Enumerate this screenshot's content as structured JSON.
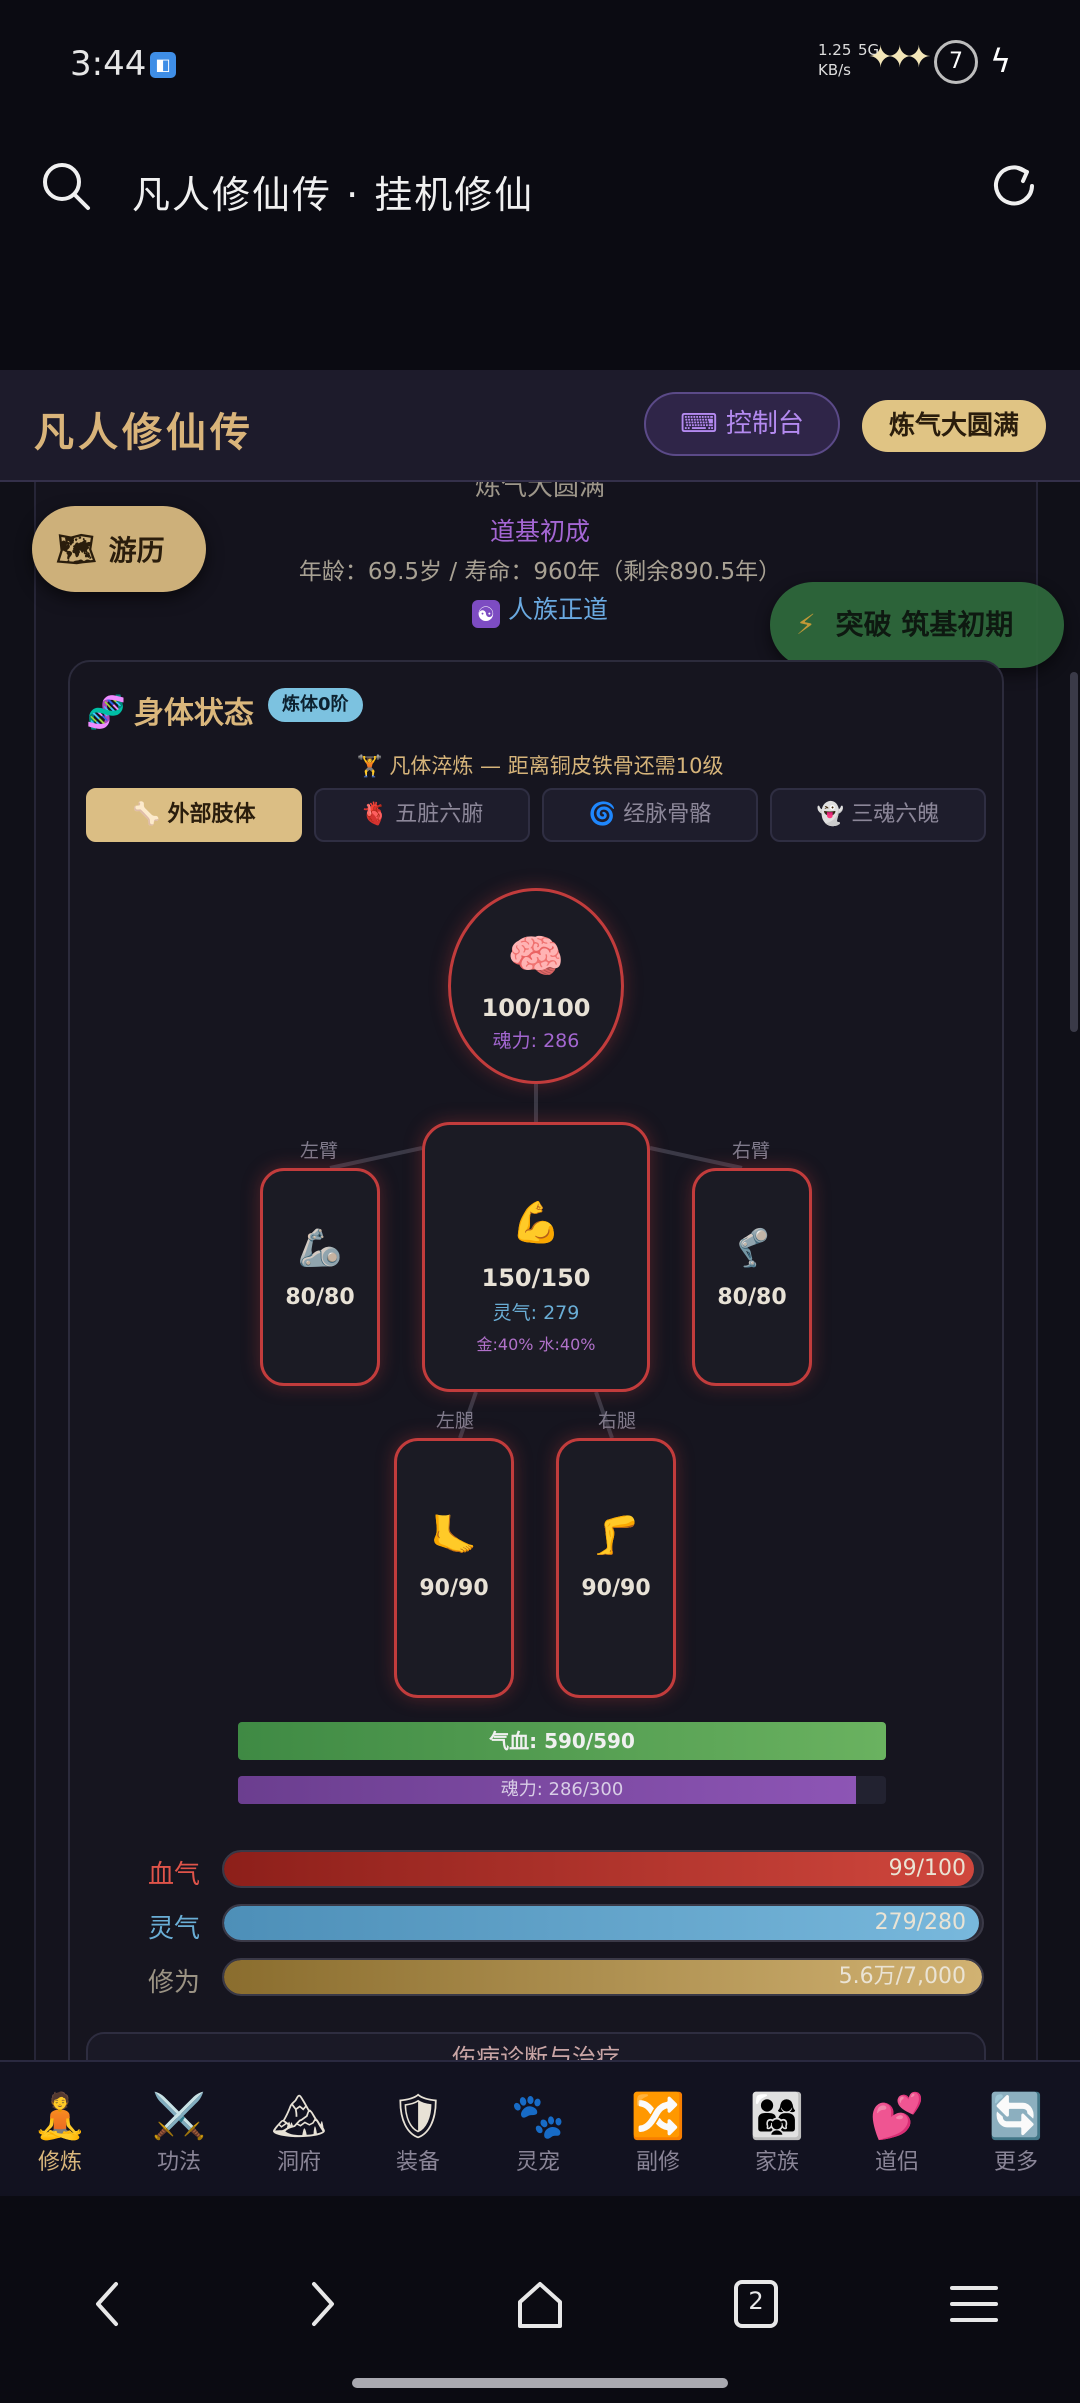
{
  "status_bar": {
    "time": "3:44",
    "net_speed": "1.25\nKB/s",
    "network": "5G",
    "battery": "7"
  },
  "browser": {
    "page_title": "凡人修仙传 · 挂机修仙"
  },
  "header": {
    "app_title": "凡人修仙传",
    "console_label": "控制台",
    "console_icon": "keyboard-icon",
    "realm_badge": "炼气大圆满"
  },
  "status": {
    "cut_text": "炼气大圆满",
    "daoji": "道基初成",
    "age": "年龄：69.5岁 / 寿命：960年（剩余890.5年）",
    "race": "人族正道"
  },
  "buttons": {
    "travel": "游历",
    "breakthrough": "突破 筑基初期"
  },
  "body_state": {
    "title": "身体状态",
    "badge": "炼体0阶",
    "progress_text": "凡体淬炼 — 距离铜皮铁骨还需10级",
    "tabs": [
      {
        "label": "外部肢体",
        "icon": "bone-icon",
        "active": true
      },
      {
        "label": "五脏六腑",
        "icon": "heart-icon",
        "active": false
      },
      {
        "label": "经脉骨骼",
        "icon": "spiral-icon",
        "active": false
      },
      {
        "label": "三魂六魄",
        "icon": "ghost-icon",
        "active": false
      }
    ],
    "parts": {
      "head": {
        "hp": "100/100",
        "sub": "魂力: 286"
      },
      "torso": {
        "hp": "150/150",
        "sub": "灵气: 279",
        "sub2": "金:40% 水:40%"
      },
      "left_arm": {
        "label": "左臂",
        "hp": "80/80"
      },
      "right_arm": {
        "label": "右臂",
        "hp": "80/80"
      },
      "left_leg": {
        "label": "左腿",
        "hp": "90/90"
      },
      "right_leg": {
        "label": "右腿",
        "hp": "90/90"
      }
    },
    "qixue_bar": {
      "text": "气血: 590/590",
      "fraction": 1.0
    },
    "hunli_bar": {
      "text": "魂力: 286/300",
      "fraction": 0.953
    }
  },
  "stats": [
    {
      "label": "血气",
      "value": "99/100",
      "fraction": 0.99,
      "color": "#c0392b"
    },
    {
      "label": "灵气",
      "value": "279/280",
      "fraction": 0.996,
      "color": "#6aaed6"
    },
    {
      "label": "修为",
      "value": "5.6万/7,000",
      "fraction": 1.0,
      "color": "#c9a35a"
    }
  ],
  "next_section": "伤病诊断与治疗",
  "bottom_nav": [
    {
      "label": "修炼",
      "icon": "meditate-icon",
      "active": true
    },
    {
      "label": "功法",
      "icon": "swords-icon",
      "active": false
    },
    {
      "label": "洞府",
      "icon": "mountain-icon",
      "active": false
    },
    {
      "label": "装备",
      "icon": "shield-icon",
      "active": false
    },
    {
      "label": "灵宠",
      "icon": "paw-icon",
      "active": false
    },
    {
      "label": "副修",
      "icon": "shuffle-icon",
      "active": false
    },
    {
      "label": "家族",
      "icon": "family-icon",
      "active": false
    },
    {
      "label": "道侣",
      "icon": "hearts-icon",
      "active": false
    },
    {
      "label": "更多",
      "icon": "refresh-icon",
      "active": false
    }
  ],
  "system_nav": {
    "tab_count": "2"
  }
}
